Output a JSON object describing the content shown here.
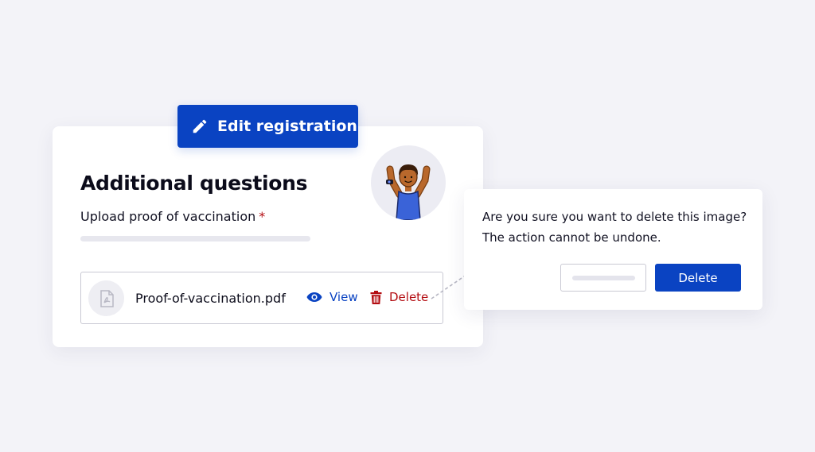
{
  "header": {
    "edit_button_label": "Edit registration",
    "edit_icon": "pencil-icon"
  },
  "form": {
    "title": "Additional questions",
    "field_label": "Upload proof of vaccination",
    "required_marker": "*",
    "avatar": "person-celebrating-avatar"
  },
  "file": {
    "icon": "pdf-file-icon",
    "name": "Proof-of-vaccination.pdf",
    "view_label": "View",
    "view_icon": "eye-icon",
    "delete_label": "Delete",
    "delete_icon": "trash-icon"
  },
  "dialog": {
    "message_line1": "Are you sure you want to delete this image?",
    "message_line2": "The action cannot be undone.",
    "confirm_label": "Delete"
  },
  "colors": {
    "background": "#f3f3f8",
    "primary": "#0a43c2",
    "danger": "#b30d12",
    "text": "#0b0b1a",
    "border": "#c9c9d3"
  }
}
